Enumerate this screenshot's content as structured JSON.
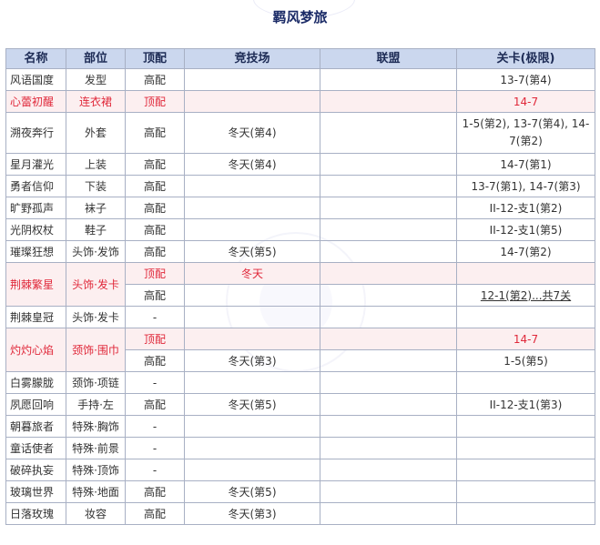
{
  "page": {
    "title": "羁风梦旅"
  },
  "table": {
    "headers": [
      "名称",
      "部位",
      "顶配",
      "竞技场",
      "联盟",
      "关卡(极限)"
    ],
    "rows": [
      {
        "name": "风语国度",
        "part": "发型",
        "top": "高配",
        "arena": "",
        "alliance": "",
        "stage": "13-7(第4)"
      },
      {
        "name": "心蕾初醒",
        "part": "连衣裙",
        "top": "顶配",
        "arena": "",
        "alliance": "",
        "stage": "14-7"
      },
      {
        "name": "溯夜奔行",
        "part": "外套",
        "top": "高配",
        "arena": "冬天(第4)",
        "alliance": "",
        "stage": "1-5(第2), 13-7(第4), 14-7(第2)"
      },
      {
        "name": "星月灌光",
        "part": "上装",
        "top": "高配",
        "arena": "冬天(第4)",
        "alliance": "",
        "stage": "14-7(第1)"
      },
      {
        "name": "勇者信仰",
        "part": "下装",
        "top": "高配",
        "arena": "",
        "alliance": "",
        "stage": "13-7(第1), 14-7(第3)"
      },
      {
        "name": "旷野孤声",
        "part": "袜子",
        "top": "高配",
        "arena": "",
        "alliance": "",
        "stage": "II-12-支1(第2)"
      },
      {
        "name": "光阴权杖",
        "part": "鞋子",
        "top": "高配",
        "arena": "",
        "alliance": "",
        "stage": "II-12-支1(第5)"
      },
      {
        "name": "璀璨狂想",
        "part": "头饰·发饰",
        "top": "高配",
        "arena": "冬天(第5)",
        "alliance": "",
        "stage": "14-7(第2)"
      }
    ],
    "thorn": {
      "name": "荆棘繁星",
      "part": "头饰·发卡",
      "top_a": "顶配",
      "arena_a": "冬天",
      "stage_a": "",
      "top_b": "高配",
      "arena_b": "",
      "stage_b": "12-1(第2)...共7关"
    },
    "rows_mid": [
      {
        "name": "荆棘皇冠",
        "part": "头饰·发卡",
        "top": "-",
        "arena": "",
        "alliance": "",
        "stage": ""
      }
    ],
    "flame": {
      "name": "灼灼心焰",
      "part": "颈饰·围巾",
      "top_a": "顶配",
      "arena_a": "",
      "stage_a": "14-7",
      "top_b": "高配",
      "arena_b": "冬天(第3)",
      "stage_b": "1-5(第5)"
    },
    "rows_end": [
      {
        "name": "白雾朦胧",
        "part": "颈饰·项链",
        "top": "-",
        "arena": "",
        "alliance": "",
        "stage": ""
      },
      {
        "name": "夙愿回响",
        "part": "手持·左",
        "top": "高配",
        "arena": "冬天(第5)",
        "alliance": "",
        "stage": "II-12-支1(第3)"
      },
      {
        "name": "朝暮旅者",
        "part": "特殊·胸饰",
        "top": "-",
        "arena": "",
        "alliance": "",
        "stage": ""
      },
      {
        "name": "童话使者",
        "part": "特殊·前景",
        "top": "-",
        "arena": "",
        "alliance": "",
        "stage": ""
      },
      {
        "name": "破碎执妄",
        "part": "特殊·顶饰",
        "top": "-",
        "arena": "",
        "alliance": "",
        "stage": ""
      },
      {
        "name": "玻璃世界",
        "part": "特殊·地面",
        "top": "高配",
        "arena": "冬天(第5)",
        "alliance": "",
        "stage": ""
      },
      {
        "name": "日落玫瑰",
        "part": "妆容",
        "top": "高配",
        "arena": "冬天(第3)",
        "alliance": "",
        "stage": ""
      }
    ]
  },
  "colors": {
    "header_bg": "#cbd7ee",
    "border": "#a8b0c4",
    "highlight_text": "#e0283a",
    "highlight_bg": "#fceff0",
    "title": "#1a2a66"
  }
}
